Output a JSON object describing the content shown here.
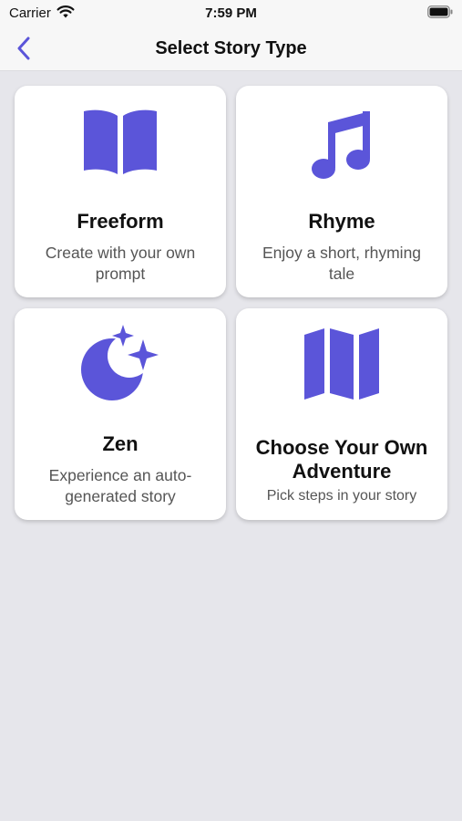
{
  "status_bar": {
    "carrier": "Carrier",
    "time": "7:59 PM"
  },
  "nav": {
    "title": "Select Story Type",
    "back_icon": "chevron-left-icon"
  },
  "colors": {
    "accent": "#5b55d9",
    "background": "#e6e6eb",
    "card": "#ffffff"
  },
  "story_types": [
    {
      "title": "Freeform",
      "description": "Create with your own prompt",
      "icon": "open-book-icon"
    },
    {
      "title": "Rhyme",
      "description": "Enjoy a short, rhyming tale",
      "icon": "music-note-icon"
    },
    {
      "title": "Zen",
      "description": "Experience an auto-generated story",
      "icon": "moon-stars-icon"
    },
    {
      "title": "Choose Your Own Adventure",
      "description": "Pick steps in your story",
      "icon": "map-icon"
    }
  ]
}
